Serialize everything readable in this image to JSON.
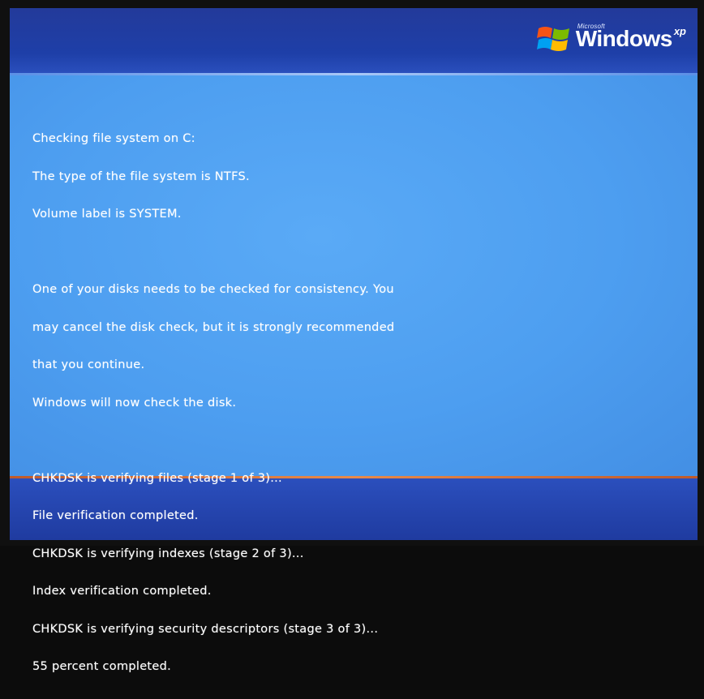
{
  "logo": {
    "brand": "Microsoft",
    "word": "Windows",
    "edition": "xp",
    "flag_colors": [
      "#f65314",
      "#7cbb00",
      "#00a1f1",
      "#ffbb00"
    ]
  },
  "colors": {
    "top_band": "#233a9a",
    "screen_body": "#4d9ef0",
    "bottom_separator": "#e88a4a",
    "text": "#ffffff"
  },
  "console": {
    "block1": [
      "Checking file system on C:",
      "The type of the file system is NTFS.",
      "Volume label is SYSTEM."
    ],
    "block2": [
      "One of your disks needs to be checked for consistency. You",
      "may cancel the disk check, but it is strongly recommended",
      "that you continue.",
      "Windows will now check the disk."
    ],
    "block3": [
      "CHKDSK is verifying files (stage 1 of 3)...",
      "File verification completed.",
      "CHKDSK is verifying indexes (stage 2 of 3)...",
      "Index verification completed.",
      "CHKDSK is verifying security descriptors (stage 3 of 3)...",
      "55 percent completed."
    ]
  }
}
